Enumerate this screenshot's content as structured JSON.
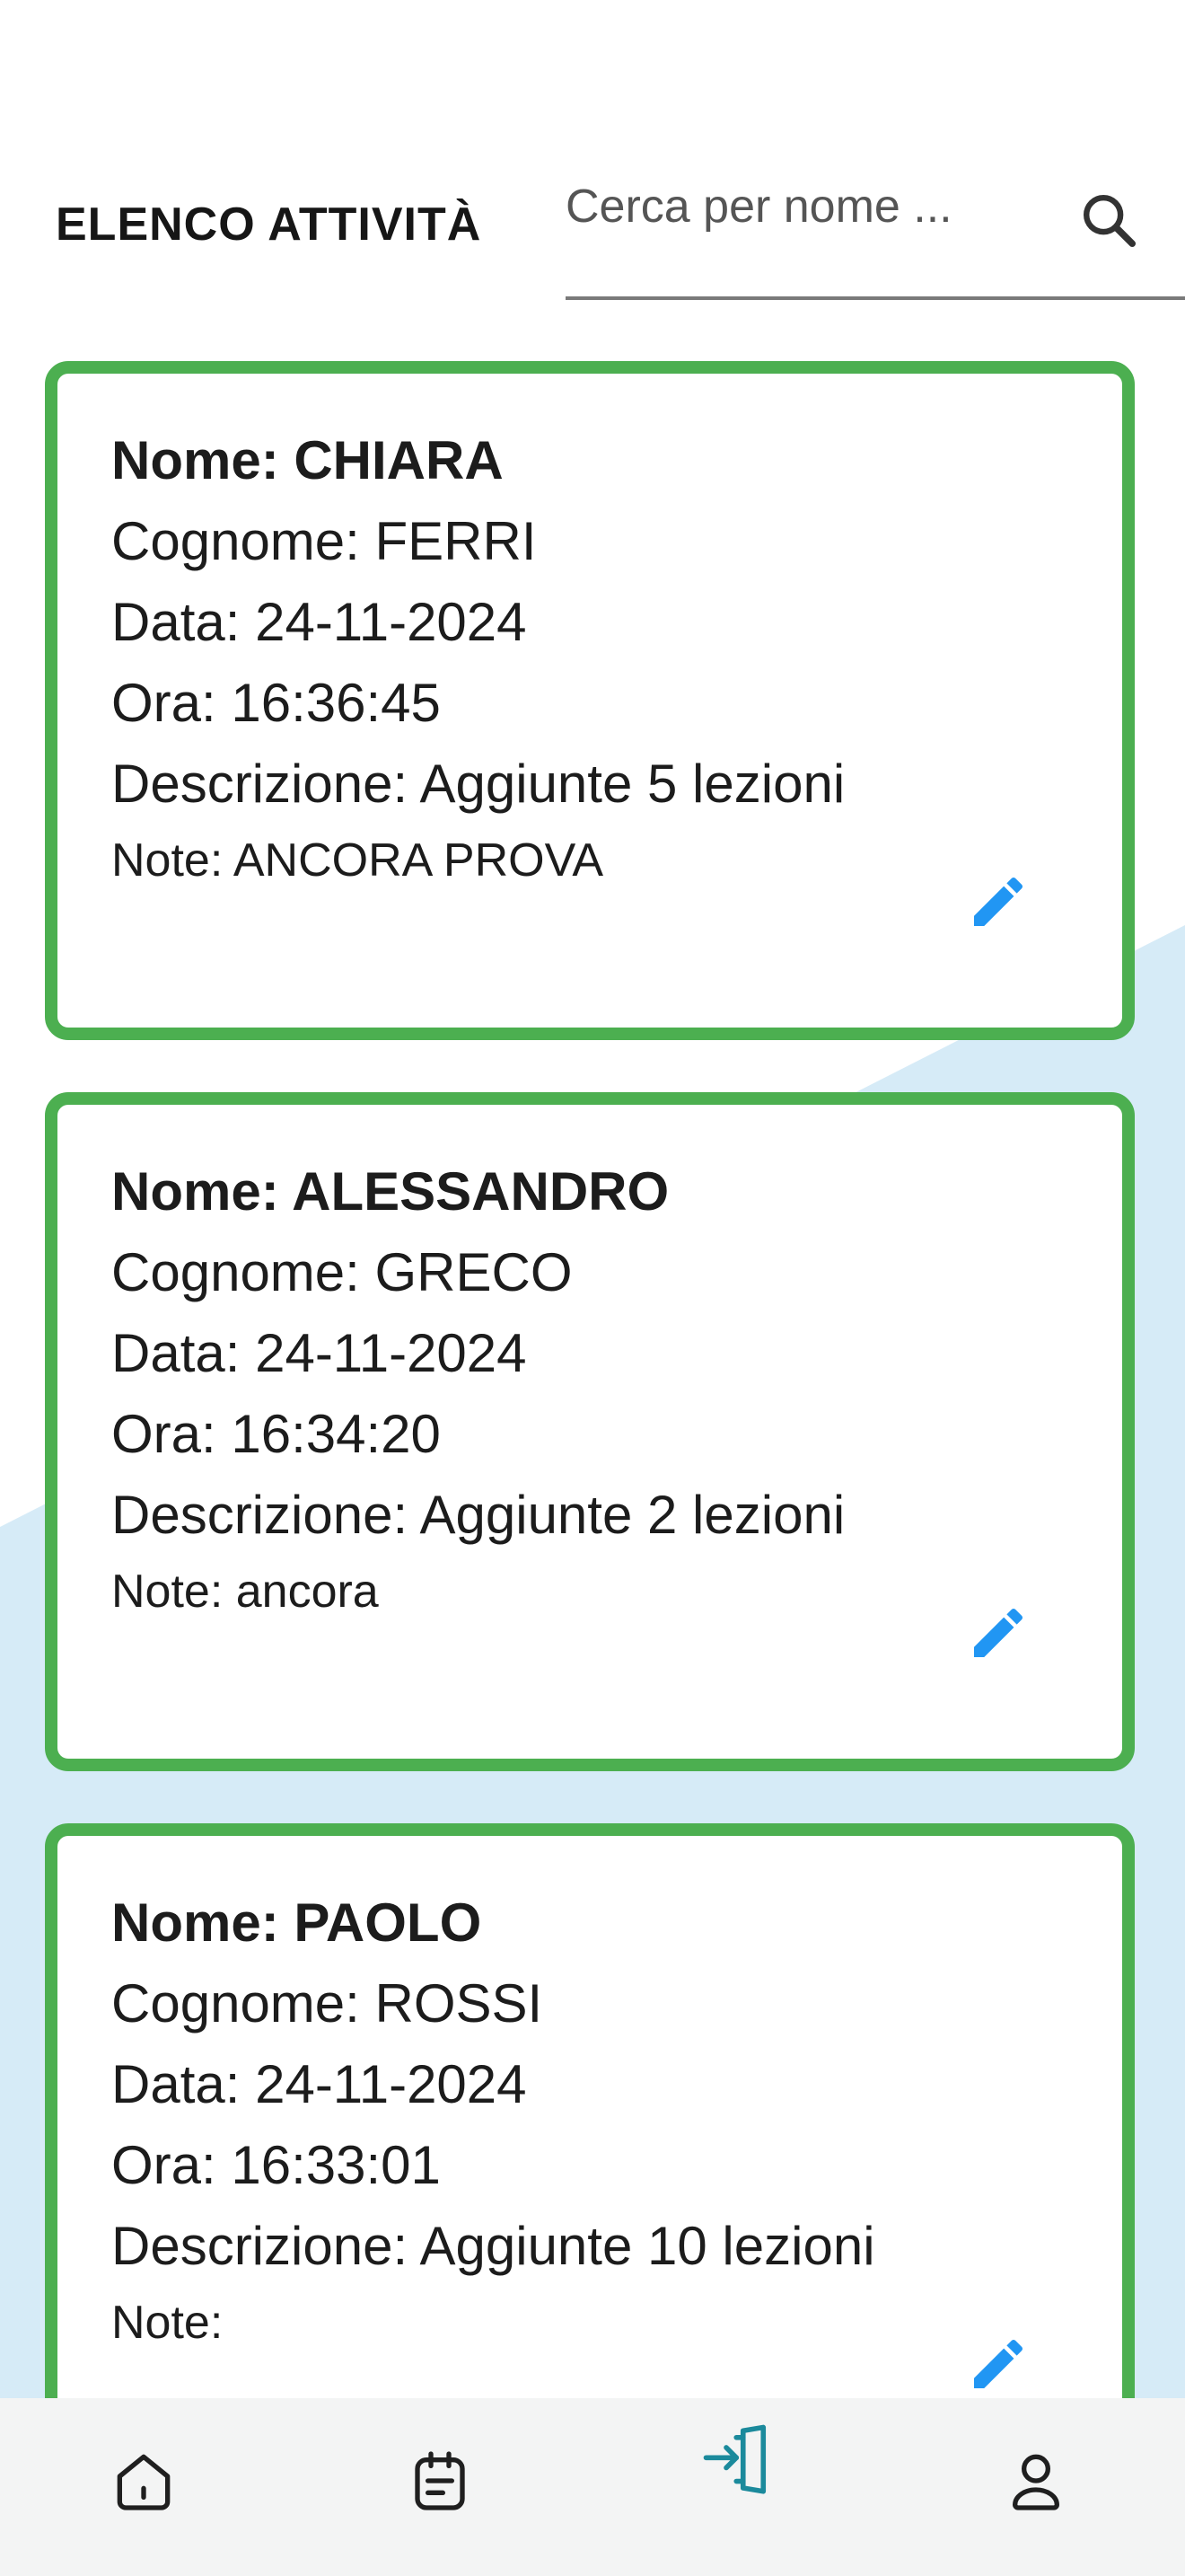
{
  "header": {
    "title": "ELENCO ATTIVITÀ",
    "search_placeholder": "Cerca per nome ..."
  },
  "activities": [
    {
      "name": "Nome: CHIARA",
      "surname": "Cognome: FERRI",
      "date": "Data: 24-11-2024",
      "time": "Ora: 16:36:45",
      "description": "Descrizione: Aggiunte 5 lezioni",
      "note": "Note: ANCORA PROVA"
    },
    {
      "name": "Nome: ALESSANDRO",
      "surname": "Cognome: GRECO",
      "date": "Data: 24-11-2024",
      "time": "Ora: 16:34:20",
      "description": "Descrizione: Aggiunte 2 lezioni",
      "note": "Note: ancora"
    },
    {
      "name": "Nome: PAOLO",
      "surname": "Cognome: ROSSI",
      "date": "Data: 24-11-2024",
      "time": "Ora: 16:33:01",
      "description": "Descrizione: Aggiunte 10 lezioni",
      "note": "Note:"
    }
  ],
  "icons": {
    "search": "search-icon",
    "edit": "pencil-icon",
    "nav": [
      "home-icon",
      "calendar-icon",
      "login-icon",
      "user-icon"
    ]
  },
  "colors": {
    "card_border": "#4caf50",
    "edit_icon": "#2196f3",
    "active_nav": "#1b8a9c",
    "background_shape": "#d6ebf7",
    "nav_background": "#f3f4f4"
  }
}
